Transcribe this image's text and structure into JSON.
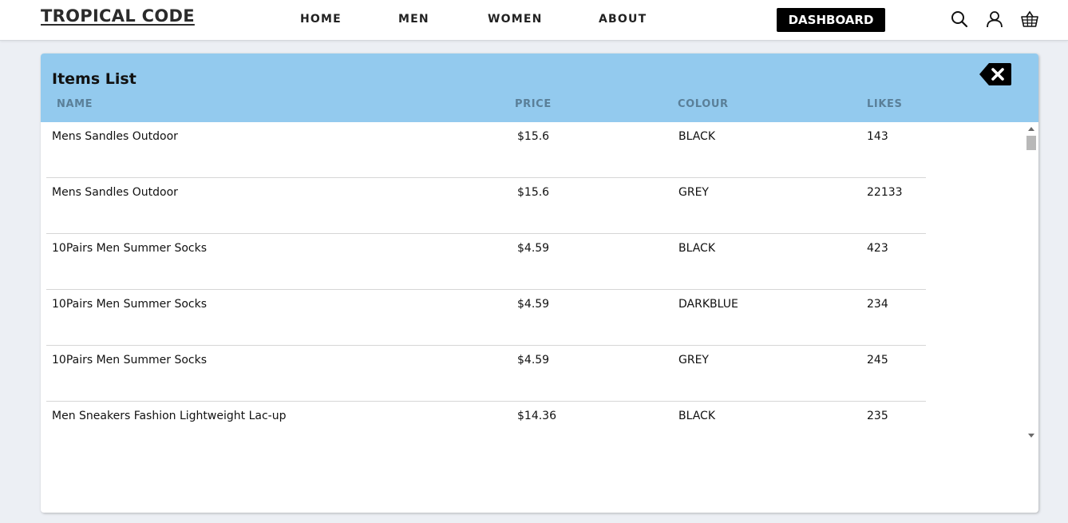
{
  "nav": {
    "brand": "TROPICAL CODE",
    "links": [
      "HOME",
      "MEN",
      "WOMEN",
      "ABOUT"
    ],
    "dashboard_label": "DASHBOARD",
    "icons": [
      "search-icon",
      "user-icon",
      "basket-icon"
    ]
  },
  "panel": {
    "title": "Items List",
    "close_icon": "backspace-close-icon",
    "header_color": "#93caee",
    "columns": [
      "NAME",
      "PRICE",
      "COLOUR",
      "LIKES"
    ],
    "rows": [
      {
        "name": "Mens Sandles Outdoor",
        "price": "$15.6",
        "colour": "BLACK",
        "likes": "143"
      },
      {
        "name": "Mens Sandles Outdoor",
        "price": "$15.6",
        "colour": "GREY",
        "likes": "22133"
      },
      {
        "name": "10Pairs Men Summer Socks",
        "price": "$4.59",
        "colour": "BLACK",
        "likes": "423"
      },
      {
        "name": "10Pairs Men Summer Socks",
        "price": "$4.59",
        "colour": "DARKBLUE",
        "likes": "234"
      },
      {
        "name": "10Pairs Men Summer Socks",
        "price": "$4.59",
        "colour": "GREY",
        "likes": "245"
      },
      {
        "name": "Men Sneakers Fashion Lightweight Lac-up",
        "price": "$14.36",
        "colour": "BLACK",
        "likes": "235"
      }
    ]
  }
}
